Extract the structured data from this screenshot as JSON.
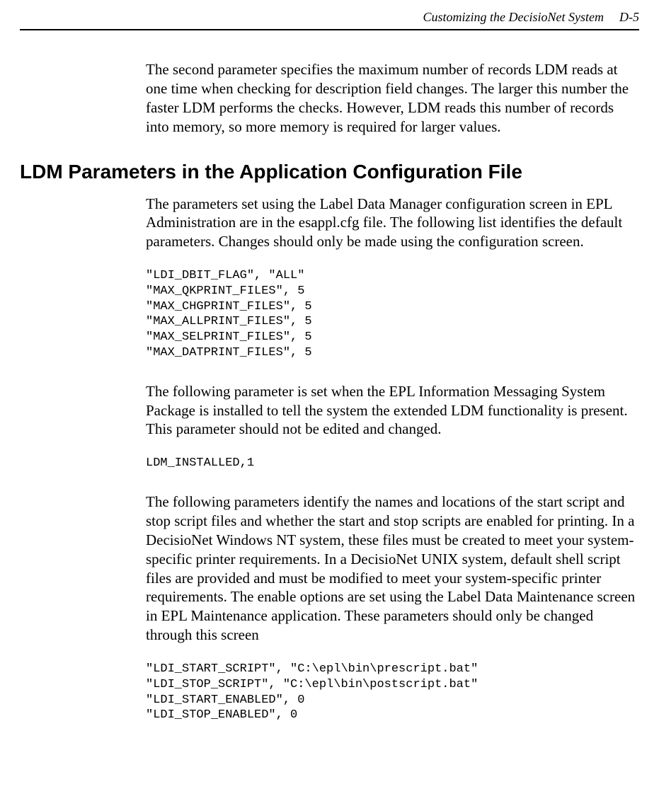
{
  "runningHead": {
    "title": "Customizing the DecisioNet System",
    "page": "D-5"
  },
  "para1": "The second parameter specifies the maximum number of records LDM reads at one time when checking for description field changes. The larger this number the faster LDM performs the checks. However, LDM reads this number of records into memory, so more memory is required for larger values.",
  "heading1": "LDM Parameters in the Application Configuration File",
  "para2": "The parameters set using the Label Data Manager configuration screen in EPL Administration are in the esappl.cfg file. The following list identifies the default parameters. Changes should only be made using the configuration screen.",
  "code1": "\"LDI_DBIT_FLAG\", \"ALL\"\n\"MAX_QKPRINT_FILES\", 5\n\"MAX_CHGPRINT_FILES\", 5\n\"MAX_ALLPRINT_FILES\", 5\n\"MAX_SELPRINT_FILES\", 5\n\"MAX_DATPRINT_FILES\", 5",
  "para3": "The following parameter is set when the EPL Information Messaging System Package is installed to tell the system the extended LDM functionality is present. This parameter should not be edited and changed.",
  "code2": "LDM_INSTALLED,1",
  "para4": "The following parameters identify the names and locations of the start script and stop script files and whether the start and stop scripts are enabled for printing. In a DecisioNet Windows NT system, these files must be created to meet your system-specific printer requirements. In a DecisioNet UNIX system, default shell script files are provided and must be modified to meet your system-specific printer requirements. The enable options are set using the Label Data Maintenance screen in EPL Maintenance application. These parameters should only be changed through this screen",
  "code3": "\"LDI_START_SCRIPT\", \"C:\\epl\\bin\\prescript.bat\"\n\"LDI_STOP_SCRIPT\", \"C:\\epl\\bin\\postscript.bat\"\n\"LDI_START_ENABLED\", 0\n\"LDI_STOP_ENABLED\", 0"
}
